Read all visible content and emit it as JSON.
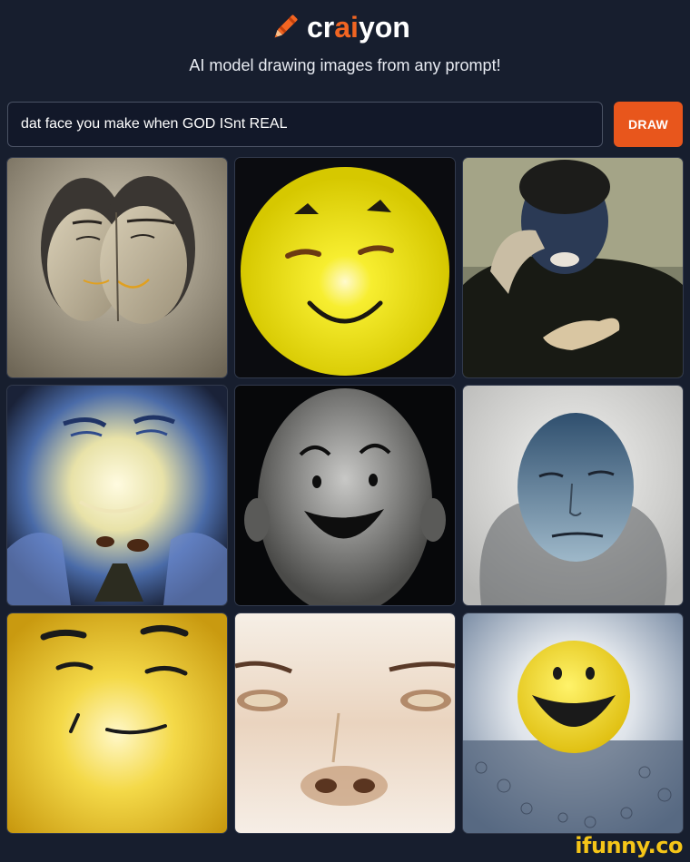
{
  "app": {
    "brand_prefix": "cr",
    "brand_ai": "ai",
    "brand_suffix": "yon",
    "tagline": "AI model drawing images from any prompt!",
    "icon": "crayon-icon"
  },
  "prompt": {
    "value": "dat face you make when GOD ISnt REAL"
  },
  "draw_button": {
    "label": "DRAW",
    "color": "#e8561c"
  },
  "brand_colors": {
    "accent": "#f26522",
    "background": "#171e2e"
  },
  "results": [
    {
      "name": "two-masked-faces"
    },
    {
      "name": "yellow-smiley-ball"
    },
    {
      "name": "man-covering-face"
    },
    {
      "name": "glowing-blue-face"
    },
    {
      "name": "bald-smiling-head"
    },
    {
      "name": "blue-sad-face"
    },
    {
      "name": "yellow-smirk-face"
    },
    {
      "name": "closeup-face"
    },
    {
      "name": "smiley-sun"
    }
  ],
  "watermark": {
    "text": "ifunny.co"
  }
}
